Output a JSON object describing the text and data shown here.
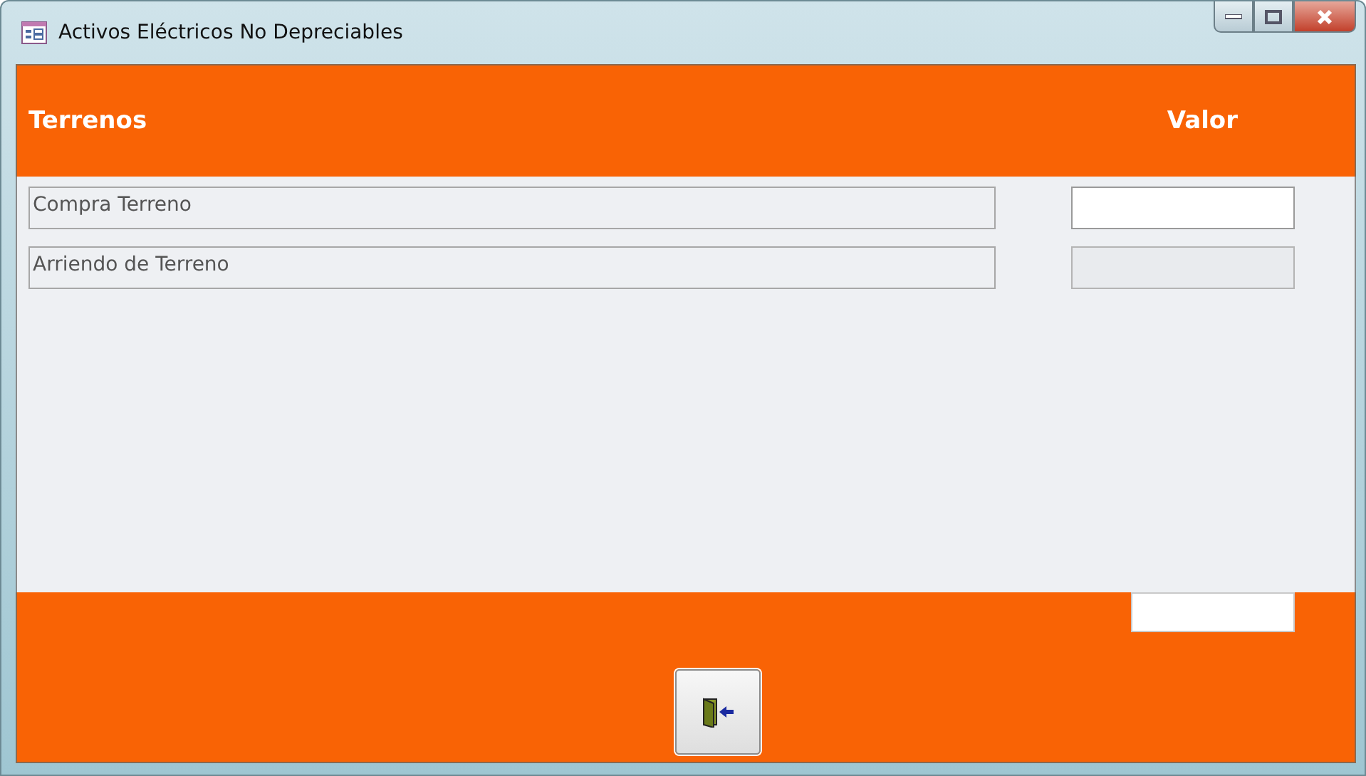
{
  "window": {
    "title": "Activos Eléctricos No Depreciables"
  },
  "header": {
    "column_1": "Terrenos",
    "column_2": "Valor"
  },
  "rows": [
    {
      "label": "Compra Terreno",
      "value_disabled": false
    },
    {
      "label": "Arriendo de Terreno",
      "value_disabled": true
    }
  ]
}
